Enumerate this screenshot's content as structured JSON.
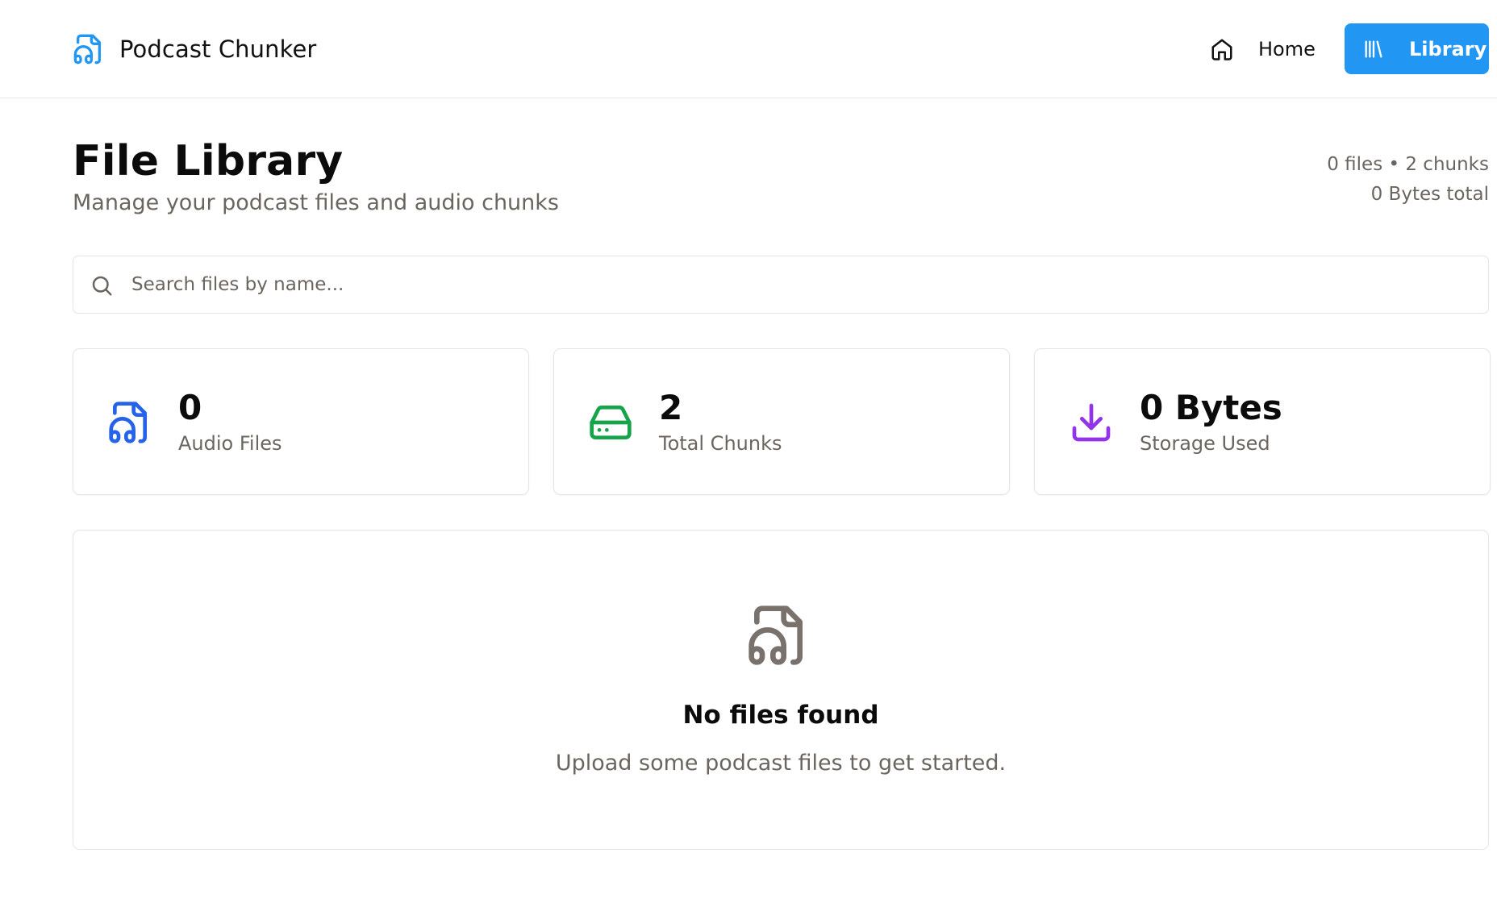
{
  "app": {
    "name": "Podcast Chunker",
    "logo_icon": "file-audio-icon"
  },
  "nav": {
    "home": {
      "label": "Home",
      "icon": "home-icon"
    },
    "library": {
      "label": "Library",
      "icon": "library-icon",
      "active": true
    }
  },
  "page": {
    "title": "File Library",
    "subtitle": "Manage your podcast files and audio chunks",
    "summary_line1": "0 files • 2 chunks",
    "summary_line2": "0 Bytes total"
  },
  "search": {
    "placeholder": "Search files by name...",
    "value": "",
    "icon": "search-icon"
  },
  "stats": [
    {
      "value": "0",
      "label": "Audio Files",
      "icon": "file-audio-icon",
      "color": "#2563eb"
    },
    {
      "value": "2",
      "label": "Total Chunks",
      "icon": "hard-drive-icon",
      "color": "#16a34a"
    },
    {
      "value": "0 Bytes",
      "label": "Storage Used",
      "icon": "download-icon",
      "color": "#9333ea"
    }
  ],
  "empty_state": {
    "icon": "file-audio-icon",
    "title": "No files found",
    "description": "Upload some podcast files to get started."
  },
  "colors": {
    "accent": "#2196f3",
    "muted_text": "#6b6560",
    "border": "#e4e4e4",
    "empty_icon": "#78716c"
  }
}
